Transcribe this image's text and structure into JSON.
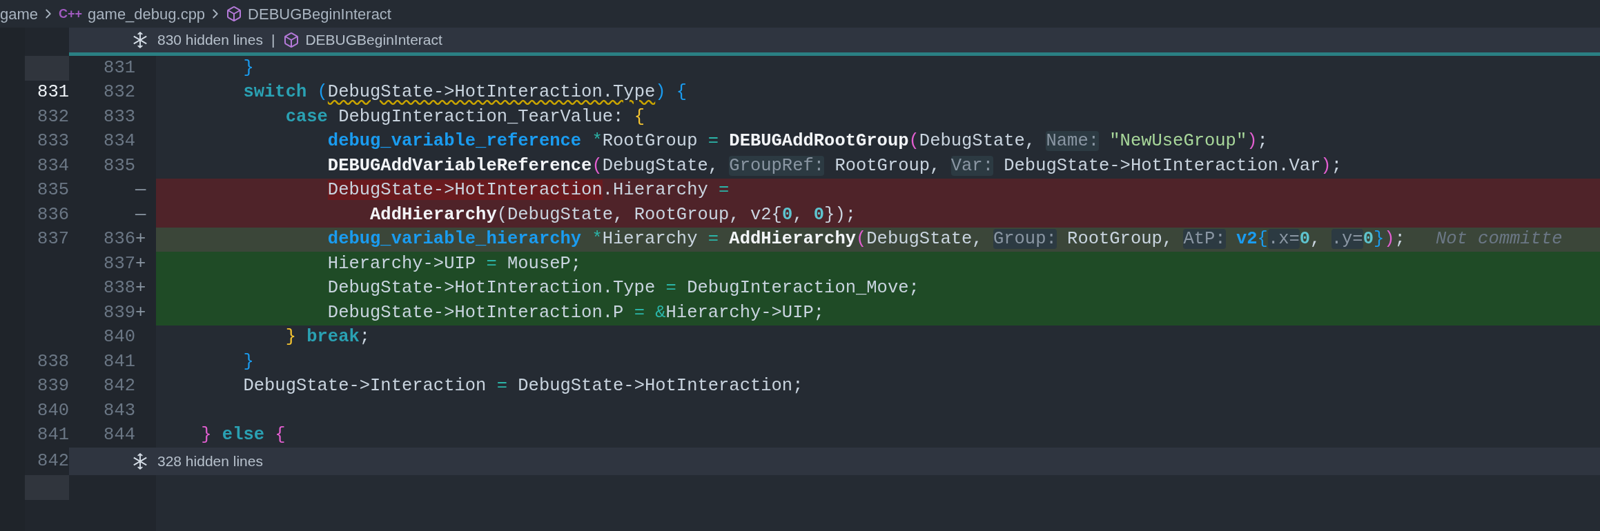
{
  "breadcrumb": {
    "folder": "game",
    "file_icon": "C++",
    "file": "game_debug.cpp",
    "symbol": "DEBUGBeginInteract"
  },
  "fold_top": {
    "label": "830 hidden lines",
    "separator": "|",
    "symbol": "DEBUGBeginInteract"
  },
  "lines": [
    {
      "new": "831",
      "removed": false,
      "added": false,
      "cursor": false,
      "highlight": false,
      "tokens": [
        {
          "kind": "b1",
          "text": "        }"
        }
      ]
    },
    {
      "old": "831",
      "new": "832",
      "removed": false,
      "added": false,
      "cursor": true,
      "highlight": false,
      "tokens": [
        {
          "kind": "kw",
          "text": "        switch"
        },
        {
          "kind": "b1",
          "text": " ("
        },
        {
          "kind": "warn",
          "text": "DebugState->HotInteraction.Type"
        },
        {
          "kind": "b1",
          "text": ") {"
        }
      ]
    },
    {
      "old": "832",
      "new": "833",
      "removed": false,
      "added": false,
      "cursor": false,
      "highlight": false,
      "tokens": [
        {
          "kind": "kw",
          "text": "            case"
        },
        {
          "kind": "txt",
          "text": " DebugInteraction_TearValue: "
        },
        {
          "kind": "b3",
          "text": "{"
        }
      ]
    },
    {
      "old": "833",
      "new": "834",
      "removed": false,
      "added": false,
      "cursor": false,
      "highlight": false,
      "tokens": [
        {
          "kind": "type",
          "text": "                debug_variable_reference"
        },
        {
          "kind": "op",
          "text": " *"
        },
        {
          "kind": "txt",
          "text": "RootGroup "
        },
        {
          "kind": "op",
          "text": "= "
        },
        {
          "kind": "fn",
          "text": "DEBUGAddRootGroup"
        },
        {
          "kind": "b2",
          "text": "("
        },
        {
          "kind": "txt",
          "text": "DebugState, "
        },
        {
          "kind": "hint",
          "text": "Name:"
        },
        {
          "kind": "str",
          "text": " \"NewUseGroup\""
        },
        {
          "kind": "b2",
          "text": ")"
        },
        {
          "kind": "txt",
          "text": ";"
        }
      ]
    },
    {
      "old": "834",
      "new": "835",
      "removed": false,
      "added": false,
      "cursor": false,
      "highlight": false,
      "tokens": [
        {
          "kind": "fn",
          "text": "                DEBUGAddVariableReference"
        },
        {
          "kind": "b2",
          "text": "("
        },
        {
          "kind": "txt",
          "text": "DebugState, "
        },
        {
          "kind": "hint",
          "text": "GroupRef:"
        },
        {
          "kind": "txt",
          "text": " RootGroup, "
        },
        {
          "kind": "hint",
          "text": "Var:"
        },
        {
          "kind": "txt",
          "text": " DebugState->HotInteraction.Var"
        },
        {
          "kind": "b2",
          "text": ")"
        },
        {
          "kind": "txt",
          "text": ";"
        }
      ]
    },
    {
      "old": "835",
      "marker": "—",
      "removed": true,
      "added": false,
      "cursor": false,
      "highlight": false,
      "tokens": [
        {
          "kind": "del",
          "text": "                DebugState->HotInteraction"
        },
        {
          "kind": "txt",
          "text": ".Hierarchy "
        },
        {
          "kind": "op",
          "text": "="
        }
      ]
    },
    {
      "old": "836",
      "marker": "—",
      "removed": true,
      "added": false,
      "cursor": false,
      "highlight": false,
      "tokens": [
        {
          "kind": "fn",
          "text": "                    AddHierarchy"
        },
        {
          "kind": "txt",
          "text": "(DebugState, RootGroup, v2{"
        },
        {
          "kind": "num",
          "text": "0"
        },
        {
          "kind": "txt",
          "text": ", "
        },
        {
          "kind": "num",
          "text": "0"
        },
        {
          "kind": "txt",
          "text": "});"
        }
      ]
    },
    {
      "old": "837",
      "new": "836",
      "marker": "+",
      "removed": false,
      "added": true,
      "cursor": false,
      "highlight": true,
      "annotation": "Not committe",
      "tokens": [
        {
          "kind": "type",
          "text": "                debug_variable_hierarchy"
        },
        {
          "kind": "op",
          "text": " *"
        },
        {
          "kind": "txt",
          "text": "Hierarchy "
        },
        {
          "kind": "op",
          "text": "= "
        },
        {
          "kind": "fn",
          "text": "AddHierarchy"
        },
        {
          "kind": "b2",
          "text": "("
        },
        {
          "kind": "txt",
          "text": "DebugState, "
        },
        {
          "kind": "hint",
          "text": "Group:"
        },
        {
          "kind": "txt",
          "text": " RootGroup, "
        },
        {
          "kind": "hint",
          "text": "AtP:"
        },
        {
          "kind": "type",
          "text": " v2"
        },
        {
          "kind": "b1",
          "text": "{"
        },
        {
          "kind": "hint",
          "text": ".x="
        },
        {
          "kind": "num",
          "text": "0"
        },
        {
          "kind": "txt",
          "text": ", "
        },
        {
          "kind": "hint",
          "text": ".y="
        },
        {
          "kind": "num",
          "text": "0"
        },
        {
          "kind": "b1",
          "text": "}"
        },
        {
          "kind": "b2",
          "text": ")"
        },
        {
          "kind": "txt",
          "text": ";"
        }
      ]
    },
    {
      "new": "837",
      "marker": "+",
      "removed": false,
      "added": true,
      "cursor": false,
      "highlight": false,
      "tokens": [
        {
          "kind": "txt",
          "text": "                Hierarchy->UIP "
        },
        {
          "kind": "op",
          "text": "="
        },
        {
          "kind": "txt",
          "text": " MouseP;"
        }
      ]
    },
    {
      "new": "838",
      "marker": "+",
      "removed": false,
      "added": true,
      "cursor": false,
      "highlight": false,
      "tokens": [
        {
          "kind": "txt",
          "text": "                DebugState->HotInteraction.Type "
        },
        {
          "kind": "op",
          "text": "="
        },
        {
          "kind": "txt",
          "text": " DebugInteraction_Move;"
        }
      ]
    },
    {
      "new": "839",
      "marker": "+",
      "removed": false,
      "added": true,
      "cursor": false,
      "highlight": false,
      "tokens": [
        {
          "kind": "txt",
          "text": "                DebugState->HotInteraction.P "
        },
        {
          "kind": "op",
          "text": "= &"
        },
        {
          "kind": "txt",
          "text": "Hierarchy->UIP;"
        }
      ]
    },
    {
      "new": "840",
      "removed": false,
      "added": false,
      "cursor": false,
      "highlight": false,
      "tokens": [
        {
          "kind": "b3",
          "text": "            }"
        },
        {
          "kind": "kw",
          "text": " break"
        },
        {
          "kind": "txt",
          "text": ";"
        }
      ]
    },
    {
      "old": "838",
      "new": "841",
      "removed": false,
      "added": false,
      "cursor": false,
      "highlight": false,
      "tokens": [
        {
          "kind": "b1",
          "text": "        }"
        }
      ]
    },
    {
      "old": "839",
      "new": "842",
      "removed": false,
      "added": false,
      "cursor": false,
      "highlight": false,
      "tokens": [
        {
          "kind": "txt",
          "text": "        DebugState->Interaction "
        },
        {
          "kind": "op",
          "text": "="
        },
        {
          "kind": "txt",
          "text": " DebugState->HotInteraction;"
        }
      ]
    },
    {
      "old": "840",
      "new": "843",
      "removed": false,
      "added": false,
      "cursor": false,
      "highlight": false
    },
    {
      "old": "841",
      "new": "844",
      "removed": false,
      "added": false,
      "cursor": false,
      "highlight": false,
      "tokens": [
        {
          "kind": "b2",
          "text": "    }"
        },
        {
          "kind": "kw",
          "text": " else"
        },
        {
          "kind": "b2",
          "text": " {"
        }
      ]
    }
  ],
  "fold_bottom": {
    "old": "842",
    "label": "328 hidden lines"
  }
}
